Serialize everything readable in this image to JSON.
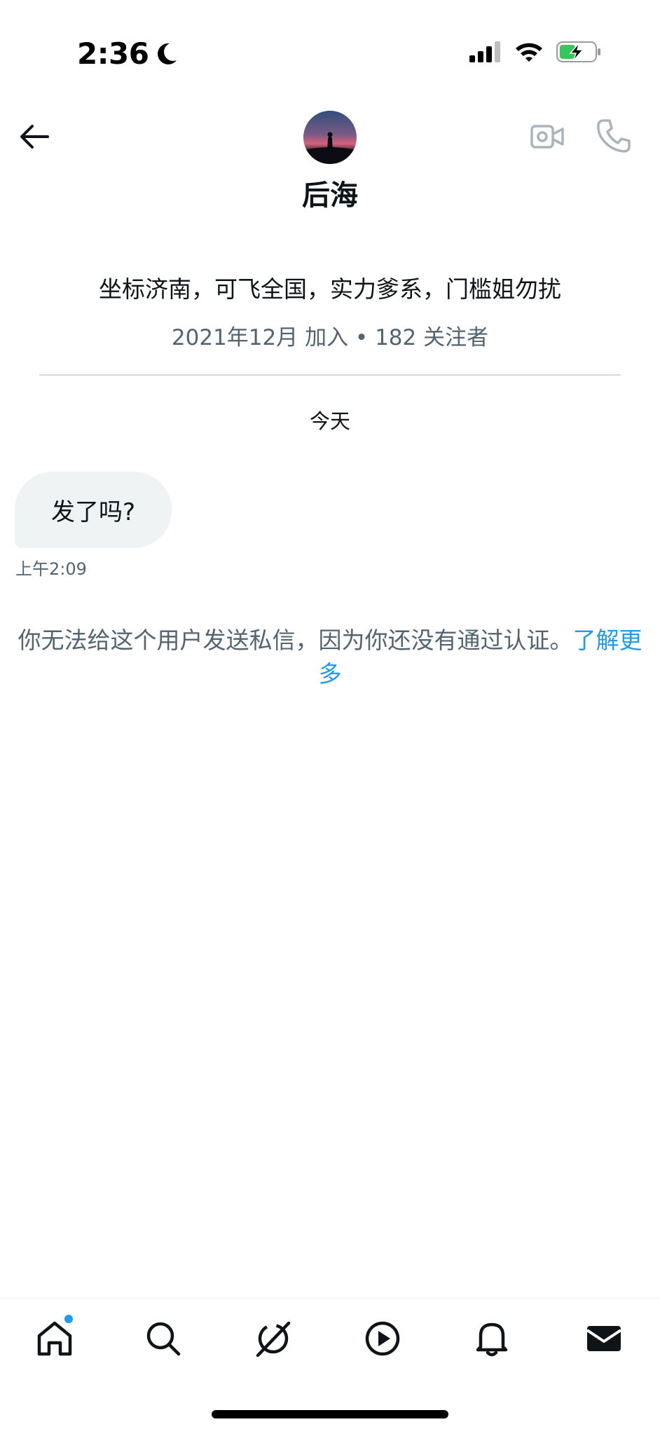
{
  "status_bar": {
    "time": "2:36"
  },
  "header": {
    "name": "后海"
  },
  "profile": {
    "bio": "坐标济南，可飞全国，实力爹系，门槛姐勿扰",
    "meta": "2021年12月 加入 • 182 关注者"
  },
  "conversation": {
    "date_separator": "今天",
    "messages": [
      {
        "text": "发了吗?",
        "time": "上午2:09"
      }
    ],
    "notice": {
      "text": "你无法给这个用户发送私信，因为你还没有通过认证。",
      "link": "了解更多"
    }
  },
  "nav": {
    "items": [
      "home-icon",
      "search-icon",
      "grok-icon",
      "video-icon",
      "bell-icon",
      "mail-icon"
    ],
    "active": "mail-icon",
    "badge_color": "#1d9bf0"
  },
  "colors": {
    "accent": "#1d9bf0",
    "secondary_text": "#536471",
    "bubble": "#eff3f4"
  }
}
